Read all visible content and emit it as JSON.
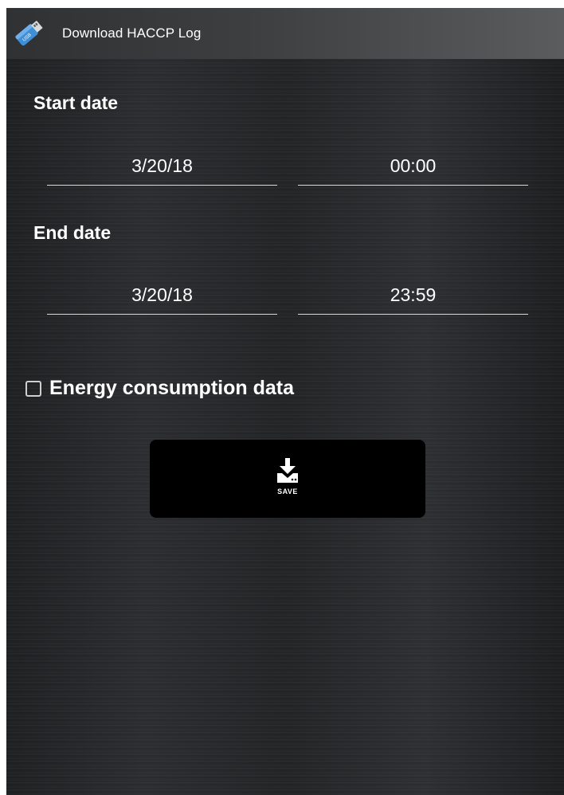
{
  "titlebar": {
    "title": "Download HACCP Log",
    "icon": "usb-drive-icon"
  },
  "start": {
    "label": "Start date",
    "date": "3/20/18",
    "time": "00:00"
  },
  "end": {
    "label": "End date",
    "date": "3/20/18",
    "time": "23:59"
  },
  "energy": {
    "label": "Energy consumption data",
    "checked": false
  },
  "save": {
    "label": "SAVE",
    "icon": "download-to-drive-icon"
  },
  "colors": {
    "text": "#ffffff",
    "button_bg": "#000000",
    "icon_blue": "#3f8fd6"
  }
}
